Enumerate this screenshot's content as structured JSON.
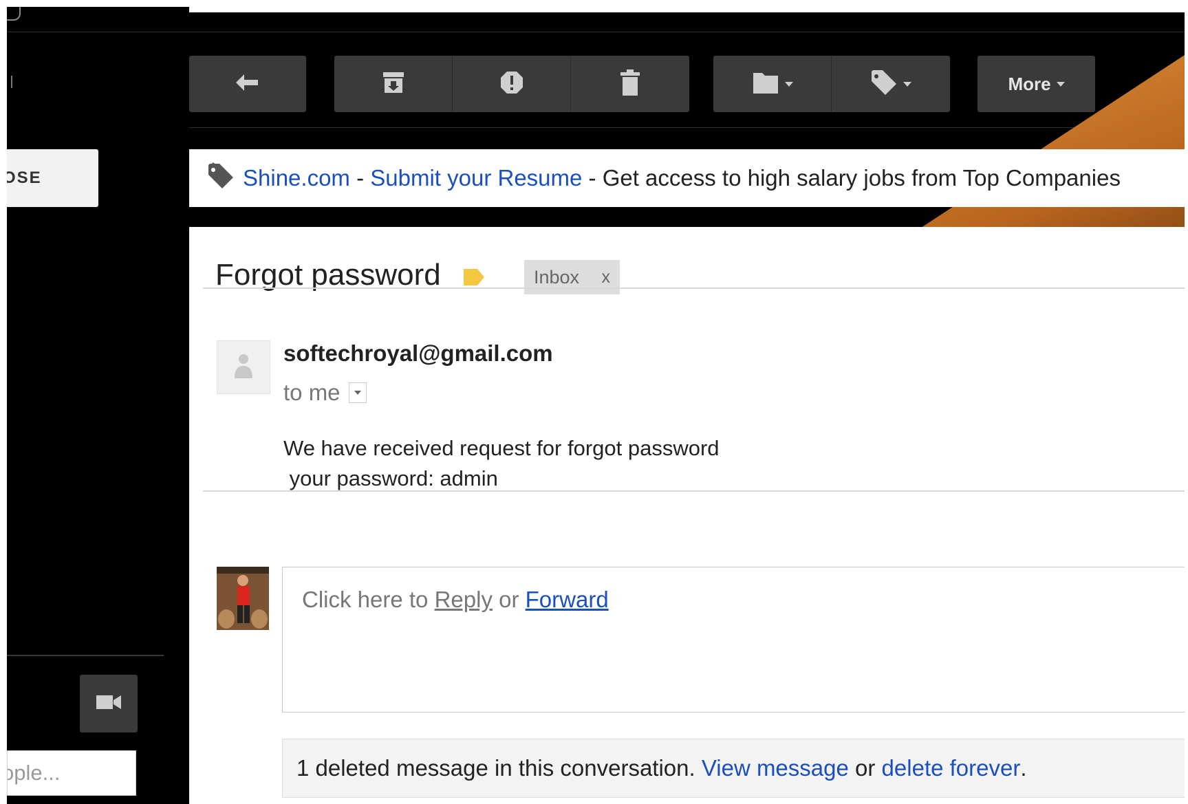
{
  "toolbar": {
    "reply_icon": "reply-icon",
    "archive_icon": "archive-icon",
    "spam_icon": "report-spam-icon",
    "delete_icon": "trash-icon",
    "move_icon": "folder-icon",
    "labels_icon": "label-tag-icon",
    "more_label": "More"
  },
  "sidebar": {
    "compose_label": "POSE",
    "people_placeholder": "ople..."
  },
  "ad": {
    "source": "Shine.com",
    "sep1": " - ",
    "link": "Submit your Resume",
    "sep2": " - ",
    "text": "Get access to high salary jobs from Top Companies"
  },
  "message": {
    "subject": "Forgot password",
    "label_chip": "Inbox",
    "label_remove": "x",
    "sender": "softechroyal@gmail.com",
    "recipient": "to me",
    "body": "We have received request for forgot password\n your password: admin"
  },
  "reply": {
    "prefix": "Click here to ",
    "reply_link": "Reply",
    "or": " or ",
    "forward_link": "Forward"
  },
  "deleted_notice": {
    "text": "1 deleted message in this conversation. ",
    "view_link": "View message",
    "or": " or ",
    "delete_link": "delete forever",
    "end": "."
  },
  "colors": {
    "link": "#1a4fbf",
    "label_yellow": "#f5c842",
    "toolbar_bg": "#3a3a3a",
    "theme_bg": "#000000"
  }
}
